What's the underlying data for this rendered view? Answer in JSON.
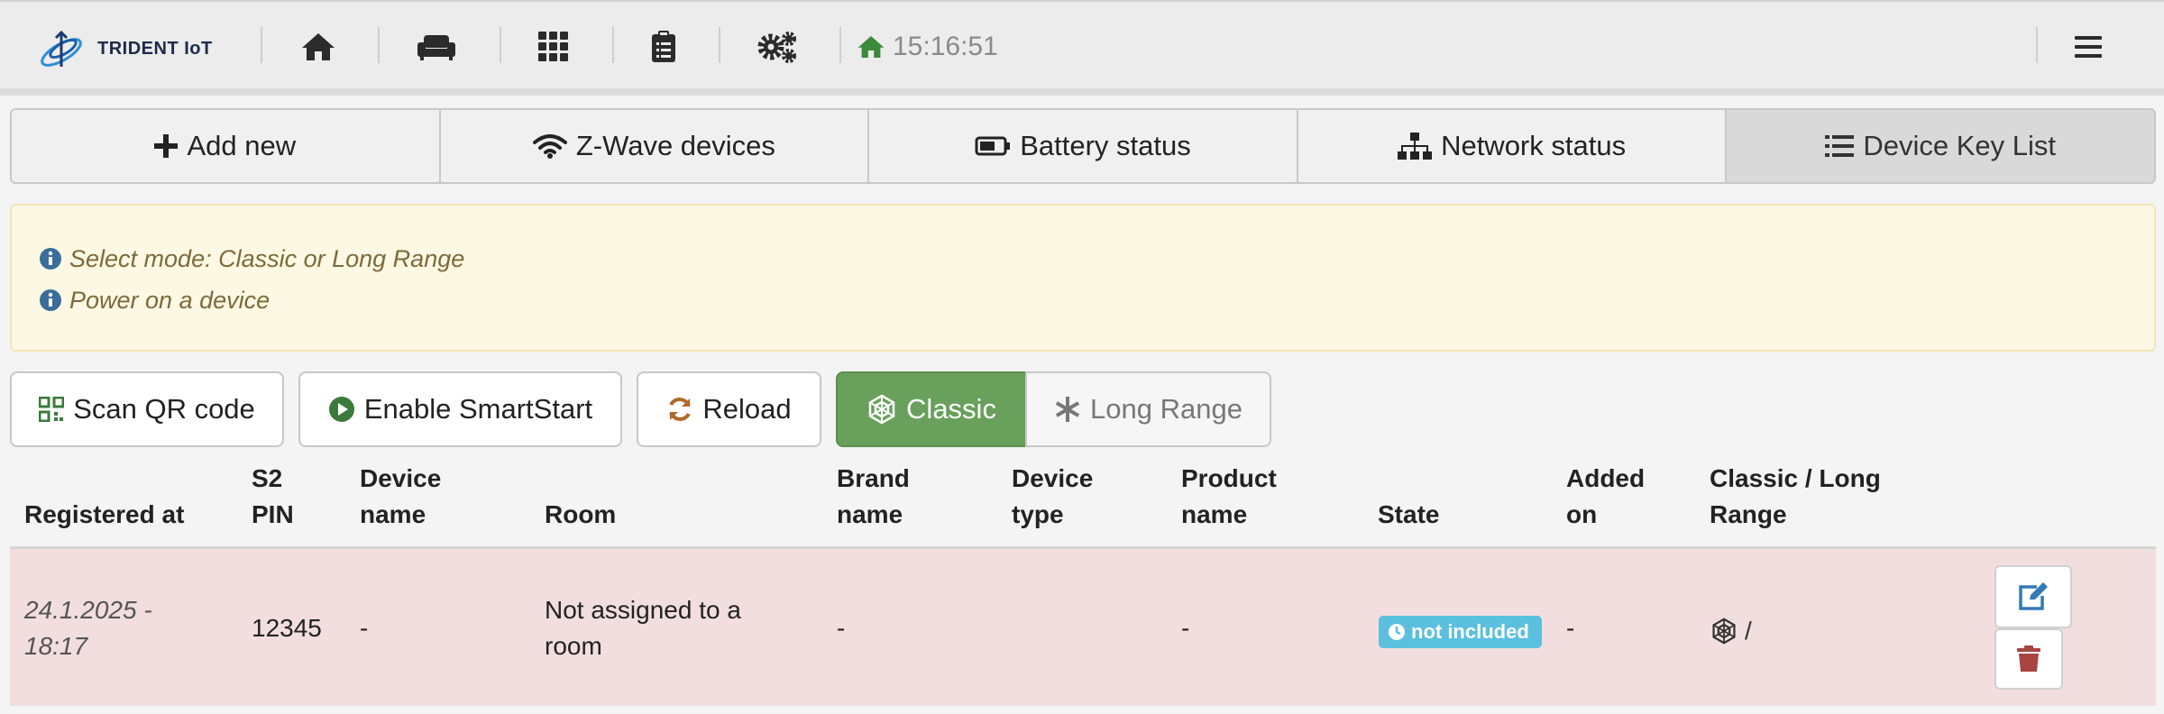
{
  "header": {
    "logo_text": "TRIDENT IoT",
    "nav_icons": [
      "home-icon",
      "couch-icon",
      "grid-icon",
      "clipboard-icon",
      "gears-icon"
    ],
    "clock": "15:16:51",
    "menu_icon": "hamburger-icon"
  },
  "tabs": [
    {
      "label": "Add new",
      "icon": "plus-icon"
    },
    {
      "label": "Z-Wave devices",
      "icon": "wifi-icon"
    },
    {
      "label": "Battery status",
      "icon": "battery-icon"
    },
    {
      "label": "Network status",
      "icon": "sitemap-icon"
    },
    {
      "label": "Device Key List",
      "icon": "list-icon",
      "active": true
    }
  ],
  "alert": {
    "lines": [
      "Select mode: Classic or Long Range",
      "Power on a device"
    ]
  },
  "actions": {
    "scan_qr": "Scan QR code",
    "enable_smartstart": "Enable SmartStart",
    "reload": "Reload",
    "mode_classic": "Classic",
    "mode_long_range": "Long Range",
    "selected_mode": "Classic"
  },
  "table": {
    "columns": {
      "registered_at": "Registered at",
      "s2_pin_1": "S2",
      "s2_pin_2": "PIN",
      "device_name_1": "Device",
      "device_name_2": "name",
      "room": "Room",
      "brand_name_1": "Brand",
      "brand_name_2": "name",
      "device_type_1": "Device",
      "device_type_2": "type",
      "product_name_1": "Product",
      "product_name_2": "name",
      "state": "State",
      "added_on_1": "Added",
      "added_on_2": "on",
      "mode_1": "Classic / Long",
      "mode_2": "Range"
    },
    "rows": [
      {
        "registered_at_1": "24.1.2025 -",
        "registered_at_2": "18:17",
        "s2_pin": "12345",
        "device_name": "-",
        "room_1": "Not assigned to a",
        "room_2": "room",
        "brand_name": "-",
        "device_type": "",
        "product_name": "-",
        "state": "not included",
        "added_on": "-",
        "mode_suffix": "/"
      }
    ]
  },
  "colors": {
    "classic_active": "#68a05c",
    "row_highlight": "#f2dede",
    "badge_info": "#5bc0de",
    "alert_bg": "#fcf8e3",
    "delete_red": "#a94442",
    "edit_blue": "#337ab7"
  }
}
